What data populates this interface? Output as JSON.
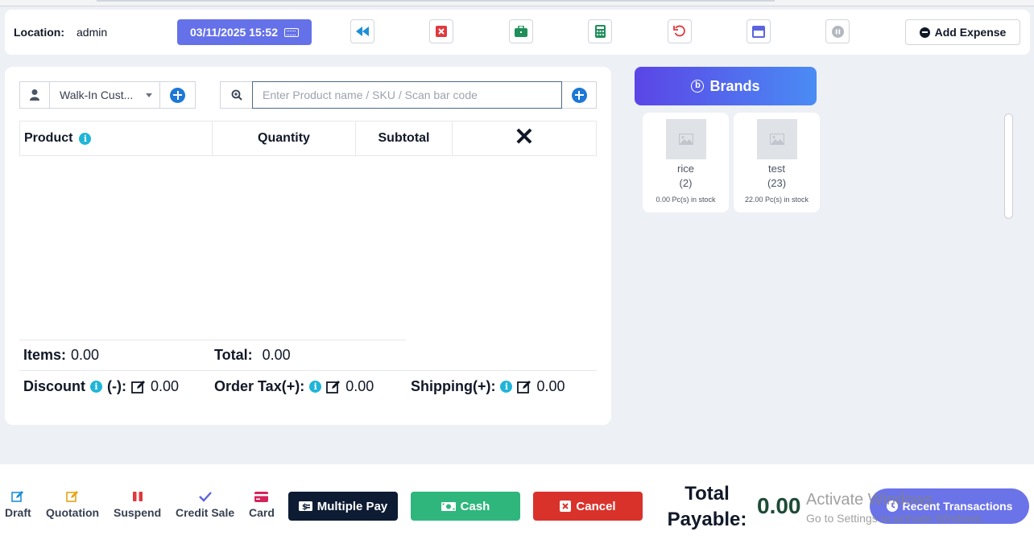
{
  "header": {
    "location_label": "Location:",
    "location_value": "admin",
    "datetime": "03/11/2025 15:52",
    "add_expense_label": "Add Expense"
  },
  "customer": {
    "selected": "Walk-In Cust..."
  },
  "search": {
    "placeholder": "Enter Product name / SKU / Scan bar code"
  },
  "table": {
    "col_product": "Product",
    "col_quantity": "Quantity",
    "col_subtotal": "Subtotal",
    "col_remove": "✕"
  },
  "summary": {
    "items_label": "Items:",
    "items_value": "0.00",
    "total_label": "Total:",
    "total_value": "0.00",
    "discount_label": "Discount",
    "discount_sign": "(-):",
    "discount_value": "0.00",
    "tax_label": "Order Tax(+):",
    "tax_value": "0.00",
    "shipping_label": "Shipping(+):",
    "shipping_value": "0.00"
  },
  "brands": {
    "button_label": "Brands",
    "products": [
      {
        "name": "rice",
        "qty": "(2)",
        "stock": "0.00 Pc(s) in stock"
      },
      {
        "name": "test",
        "qty": "(23)",
        "stock": "22.00 Pc(s) in stock"
      }
    ]
  },
  "footer": {
    "draft": "Draft",
    "quotation": "Quotation",
    "suspend": "Suspend",
    "credit_sale": "Credit Sale",
    "card": "Card",
    "multiple_pay": "Multiple Pay",
    "cash": "Cash",
    "cancel": "Cancel",
    "total_payable_label": "Total Payable:",
    "total_payable_value": "0.00",
    "recent_transactions": "Recent Transactions"
  },
  "watermark": {
    "line1": "Activate Windows",
    "line2": "Go to Settings to activate Windows."
  },
  "colors": {
    "accent": "#6571e8",
    "success": "#2fb67c",
    "danger": "#d9322a",
    "dark": "#0d1b33",
    "info": "#1fb5d8"
  }
}
